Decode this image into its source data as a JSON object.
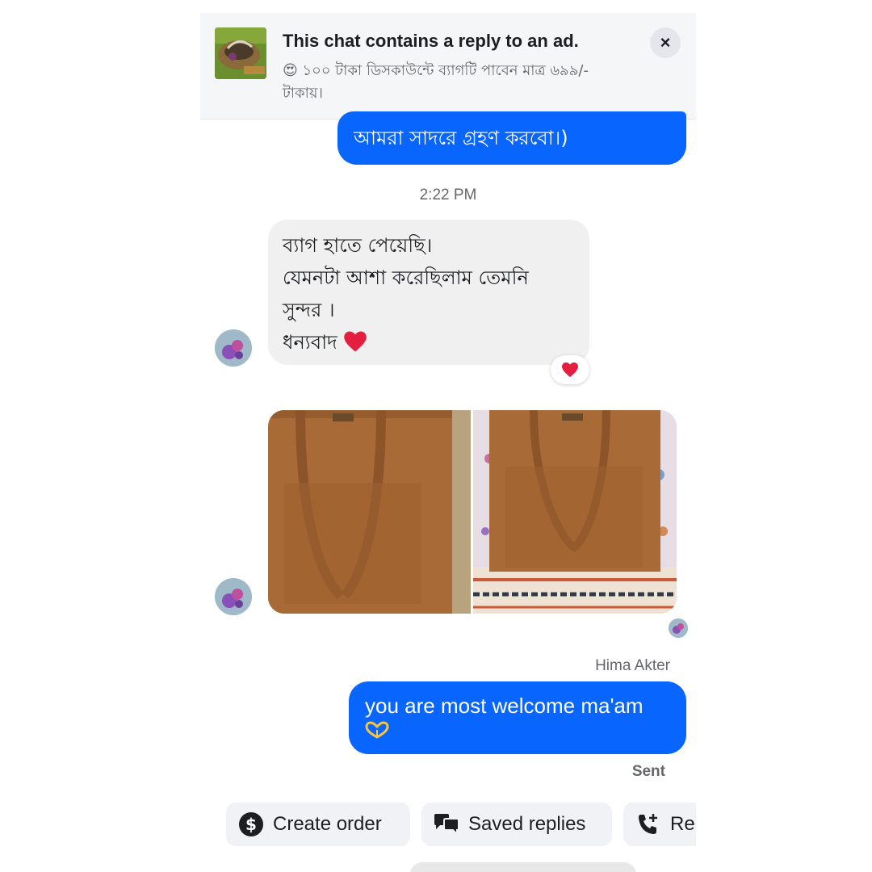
{
  "ad_banner": {
    "title": "This chat contains a reply to an ad.",
    "subtitle_emoji": "😍",
    "subtitle": "১০০ টাকা ডিসকাউন্টে ব্যাগটি পাবেন মাত্র ৬৯৯/- টাকায়।",
    "close_label": "×"
  },
  "messages": {
    "previous_outgoing": "আমরা সাদরে গ্রহণ করবো।)",
    "timestamp": "2:22 PM",
    "received_lines": [
      "ব্যাগ হাতে পেয়েছি।",
      "যেমনটা আশা করেছিলাম তেমনি",
      "সুন্দর ।",
      "ধন্যবাদ"
    ],
    "reaction": "heart",
    "sender_name": "Hima Akter",
    "sent_text": "you are most welcome ma'am",
    "sent_emoji": "heart-hands",
    "sent_status": "Sent"
  },
  "quick_actions": [
    {
      "label": "Create order",
      "icon": "dollar-icon"
    },
    {
      "label": "Saved replies",
      "icon": "chat-bubbles-icon"
    },
    {
      "label": "Re",
      "icon": "phone-plus-icon"
    }
  ],
  "colors": {
    "outgoing_bubble": "#0866ff",
    "incoming_bubble": "#f0f0f0",
    "heart": "#e41e3f",
    "bag_brown": "#a86a36"
  }
}
